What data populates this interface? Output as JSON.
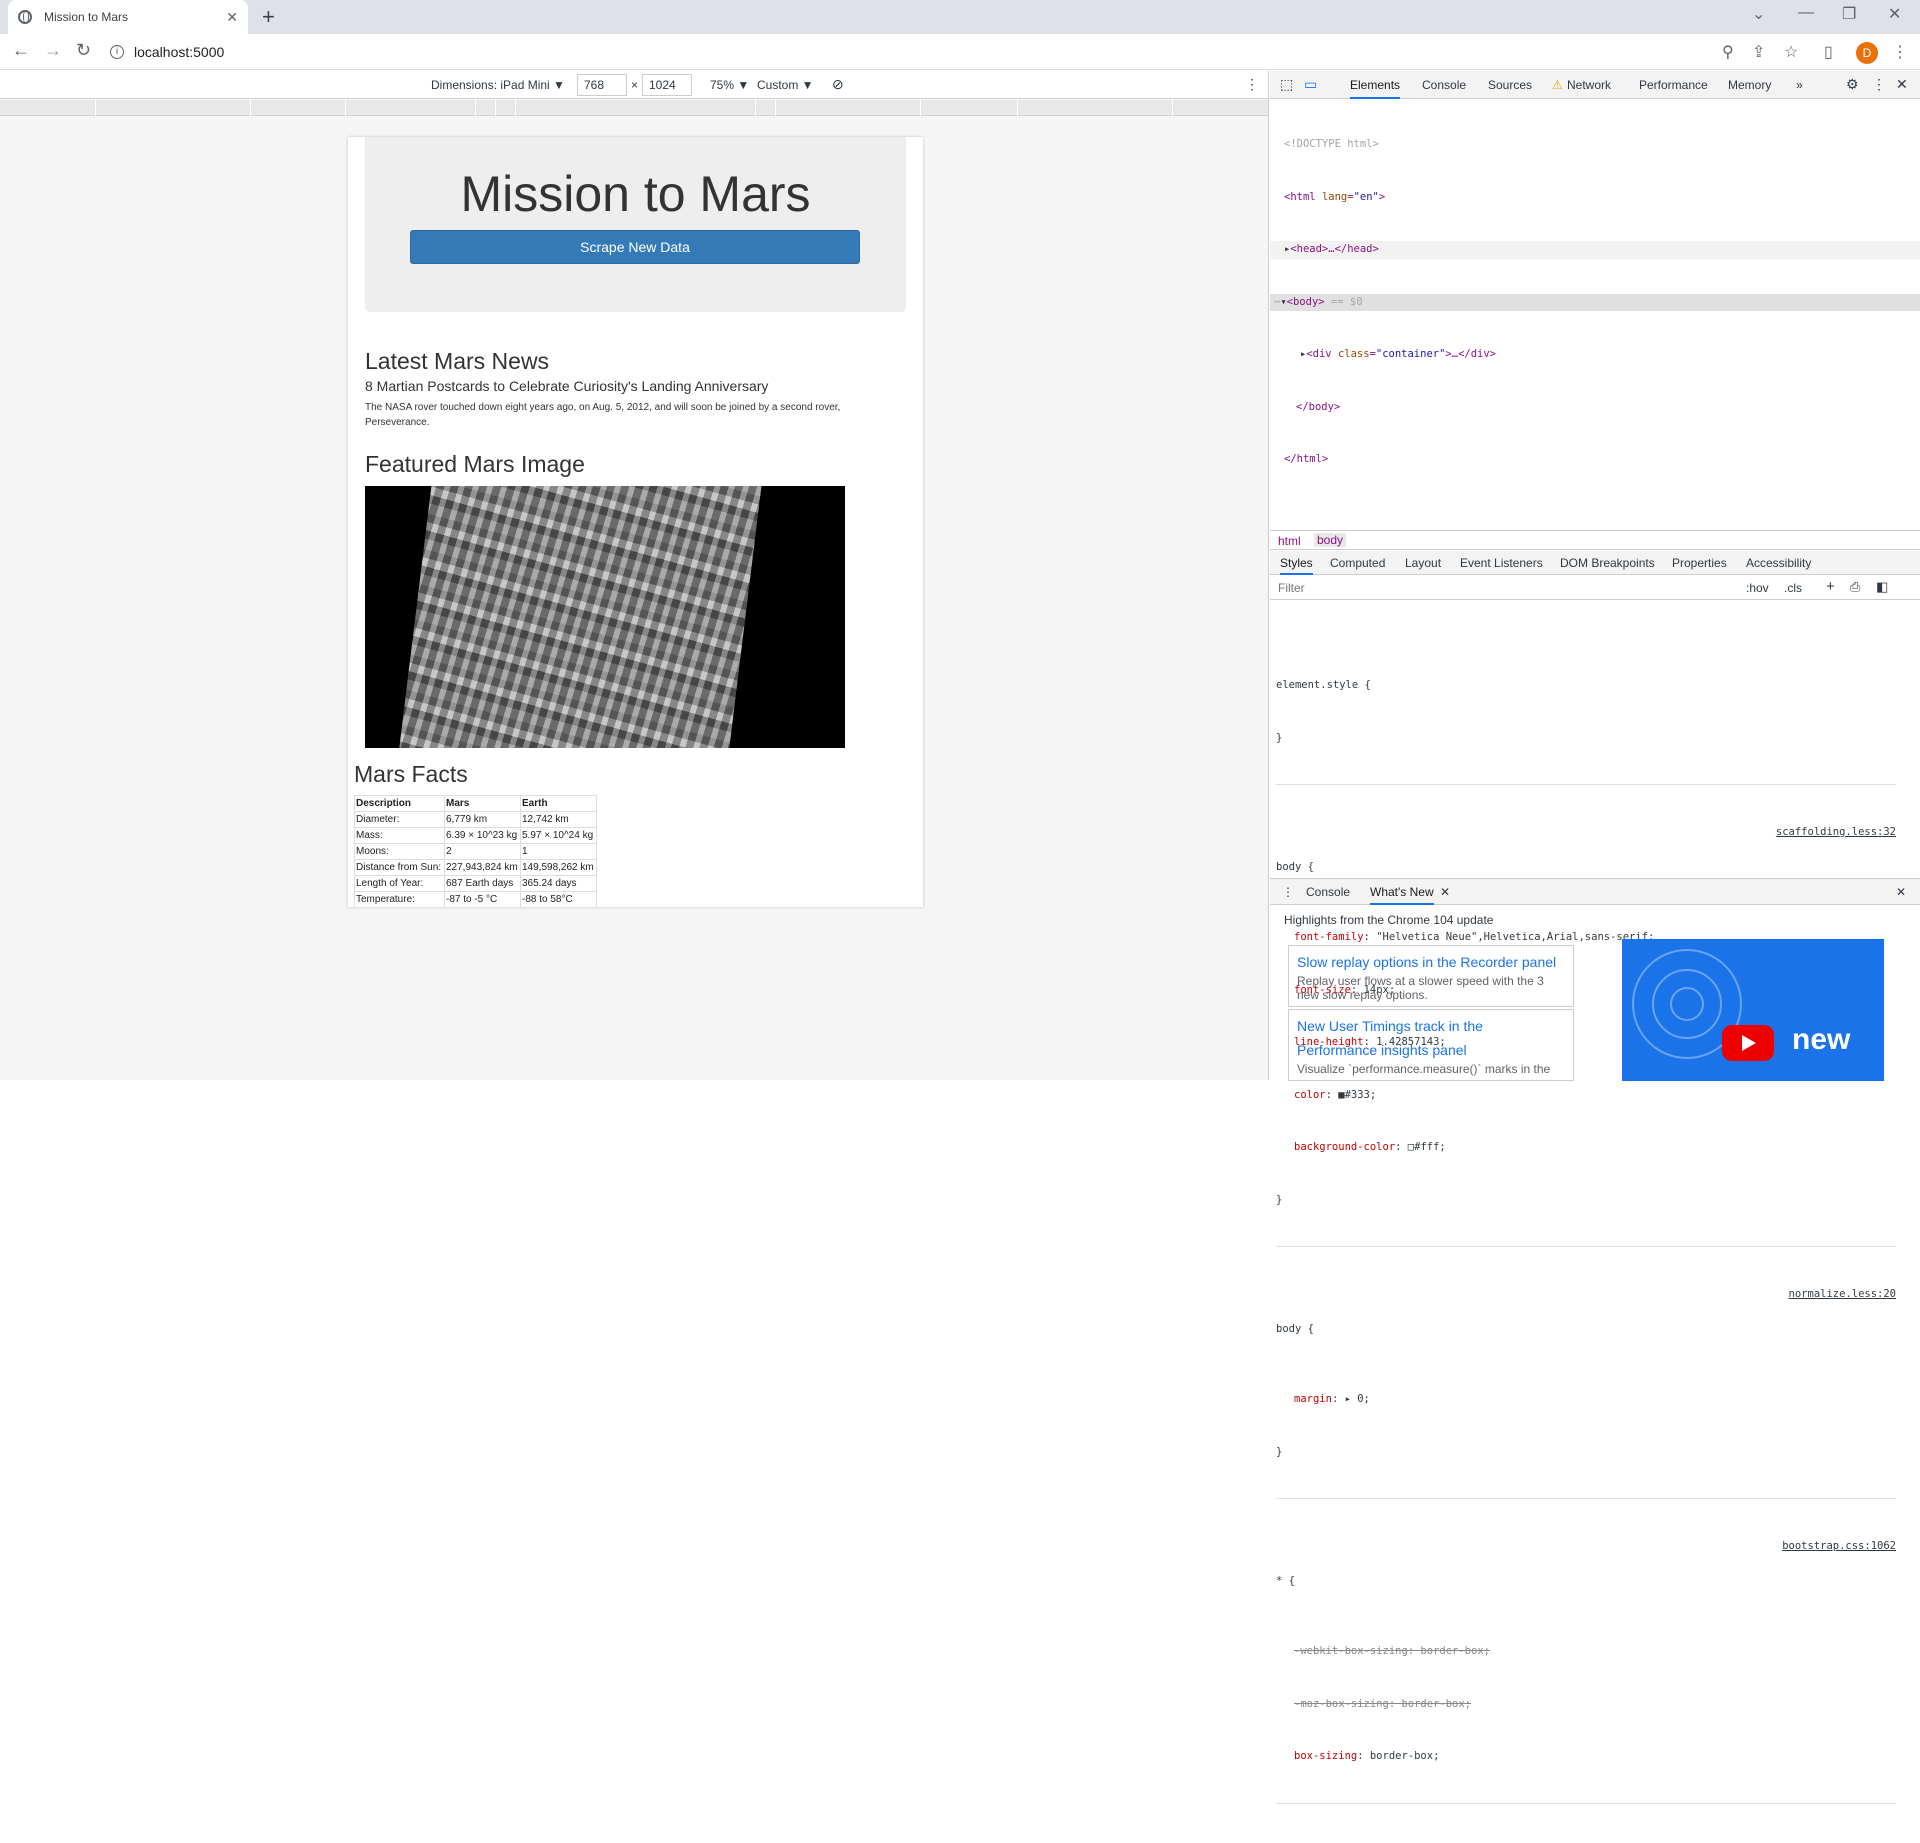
{
  "browser": {
    "tab_title": "Mission to Mars",
    "url": "localhost:5000",
    "avatar_letter": "D"
  },
  "device_toolbar": {
    "dimensions_label": "Dimensions: iPad Mini ▼",
    "width": "768",
    "times": "×",
    "height": "1024",
    "zoom": "75% ▼",
    "throttle": "Custom ▼"
  },
  "page": {
    "title": "Mission to Mars",
    "scrape_button": "Scrape New Data",
    "news_heading": "Latest Mars News",
    "news_title": "8 Martian Postcards to Celebrate Curiosity's Landing Anniversary",
    "news_paragraph": "The NASA rover touched down eight years ago, on Aug. 5, 2012, and will soon be joined by a second rover, Perseverance.",
    "featured_heading": "Featured Mars Image",
    "facts_heading": "Mars Facts",
    "facts_table": {
      "headers": [
        "Description",
        "Mars",
        "Earth"
      ],
      "rows": [
        [
          "Diameter:",
          "6,779 km",
          "12,742 km"
        ],
        [
          "Mass:",
          "6.39 × 10^23 kg",
          "5.97 × 10^24 kg"
        ],
        [
          "Moons:",
          "2",
          "1"
        ],
        [
          "Distance from Sun:",
          "227,943,824 km",
          "149,598,262 km"
        ],
        [
          "Length of Year:",
          "687 Earth days",
          "365.24 days"
        ],
        [
          "Temperature:",
          "-87 to -5 °C",
          "-88 to 58°C"
        ]
      ]
    }
  },
  "devtools": {
    "tabs": [
      "Elements",
      "Console",
      "Sources",
      "Network",
      "Performance",
      "Memory",
      "»"
    ],
    "dom": {
      "doctype": "<!DOCTYPE html>",
      "html_open_tag": "<html ",
      "html_attr": "lang",
      "html_attr_eq": "=",
      "html_attr_val": "\"en\"",
      "html_open_end": ">",
      "head": "<head>…</head>",
      "body_open": "<body>",
      "body_sel": " == $0",
      "div_open": "<div ",
      "div_attr": "class",
      "div_attr_eq": "=",
      "div_attr_val": "\"container\"",
      "div_end": ">…</div>",
      "body_close": "</body>",
      "html_close": "</html>"
    },
    "breadcrumbs": [
      "html",
      "body"
    ],
    "subtabs": [
      "Styles",
      "Computed",
      "Layout",
      "Event Listeners",
      "DOM Breakpoints",
      "Properties",
      "Accessibility"
    ],
    "filter_placeholder": "Filter",
    "filter_hov": ":hov",
    "filter_cls": ".cls",
    "styles": {
      "element_style_open": "element.style {",
      "close": "}",
      "rule1_sel": "body {",
      "rule1_src": "scaffolding.less:32",
      "rule1_props": [
        [
          "font-family",
          ": \"Helvetica Neue\",Helvetica,Arial,sans-serif;"
        ],
        [
          "font-size",
          ": 14px;"
        ],
        [
          "line-height",
          ": 1.42857143;"
        ],
        [
          "color",
          ": ■#333;"
        ],
        [
          "background-color",
          ": □#fff;"
        ]
      ],
      "rule2_sel": "body {",
      "rule2_src": "normalize.less:20",
      "rule2_prop": "margin",
      "rule2_val": ": ▸ 0;",
      "rule3_sel": "* {",
      "rule3_src": "bootstrap.css:1062",
      "rule3_props": [
        "-webkit-box-sizing: border-box;",
        "-moz-box-sizing: border-box;"
      ],
      "rule3_prop3": "box-sizing",
      "rule3_val3": ": border-box;"
    },
    "drawer": {
      "tabs": [
        "Console",
        "What's New"
      ],
      "close_tab": "✕",
      "headline": "Highlights from the Chrome 104 update",
      "card1_title": "Slow replay options in the Recorder panel",
      "card1_desc": "Replay user flows at a slower speed with the 3 new slow replay options.",
      "card2_title": "New User Timings track in the Performance insights panel",
      "card2_desc": "Visualize `performance.measure()` marks in the",
      "video_text": "new"
    }
  },
  "colors": {
    "bootstrap_primary": "#337ab7",
    "jumbotron_bg": "#eeeeee",
    "avatar": "#e8710a",
    "devtools_active": "#1a73e8"
  }
}
